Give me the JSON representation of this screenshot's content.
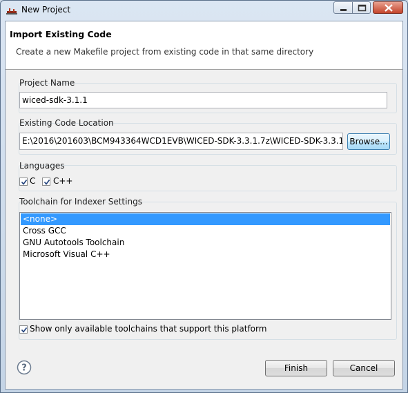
{
  "window": {
    "title": "New Project"
  },
  "header": {
    "title": "Import Existing Code",
    "description": "Create a new Makefile project from existing code in that same directory"
  },
  "project_name": {
    "label": "Project Name",
    "value": "wiced-sdk-3.1.1"
  },
  "code_location": {
    "label": "Existing Code Location",
    "value": "E:\\2016\\201603\\BCM943364WCD1EVB\\WICED-SDK-3.3.1.7z\\WICED-SDK-3.3.1",
    "browse_label": "Browse..."
  },
  "languages": {
    "label": "Languages",
    "items": [
      {
        "label": "C",
        "checked": true
      },
      {
        "label": "C++",
        "checked": true
      }
    ]
  },
  "toolchain": {
    "label": "Toolchain for Indexer Settings",
    "items": [
      "<none>",
      "Cross GCC",
      "GNU Autotools Toolchain",
      "Microsoft Visual C++"
    ],
    "selected_index": 0,
    "show_only_label": "Show only available toolchains that support this platform",
    "show_only_checked": true
  },
  "footer": {
    "finish_label": "Finish",
    "cancel_label": "Cancel"
  },
  "icons": {
    "app": "new-project-icon",
    "help": "question-mark-icon",
    "minimize": "minimize-icon",
    "maximize": "maximize-icon",
    "close": "close-icon"
  }
}
